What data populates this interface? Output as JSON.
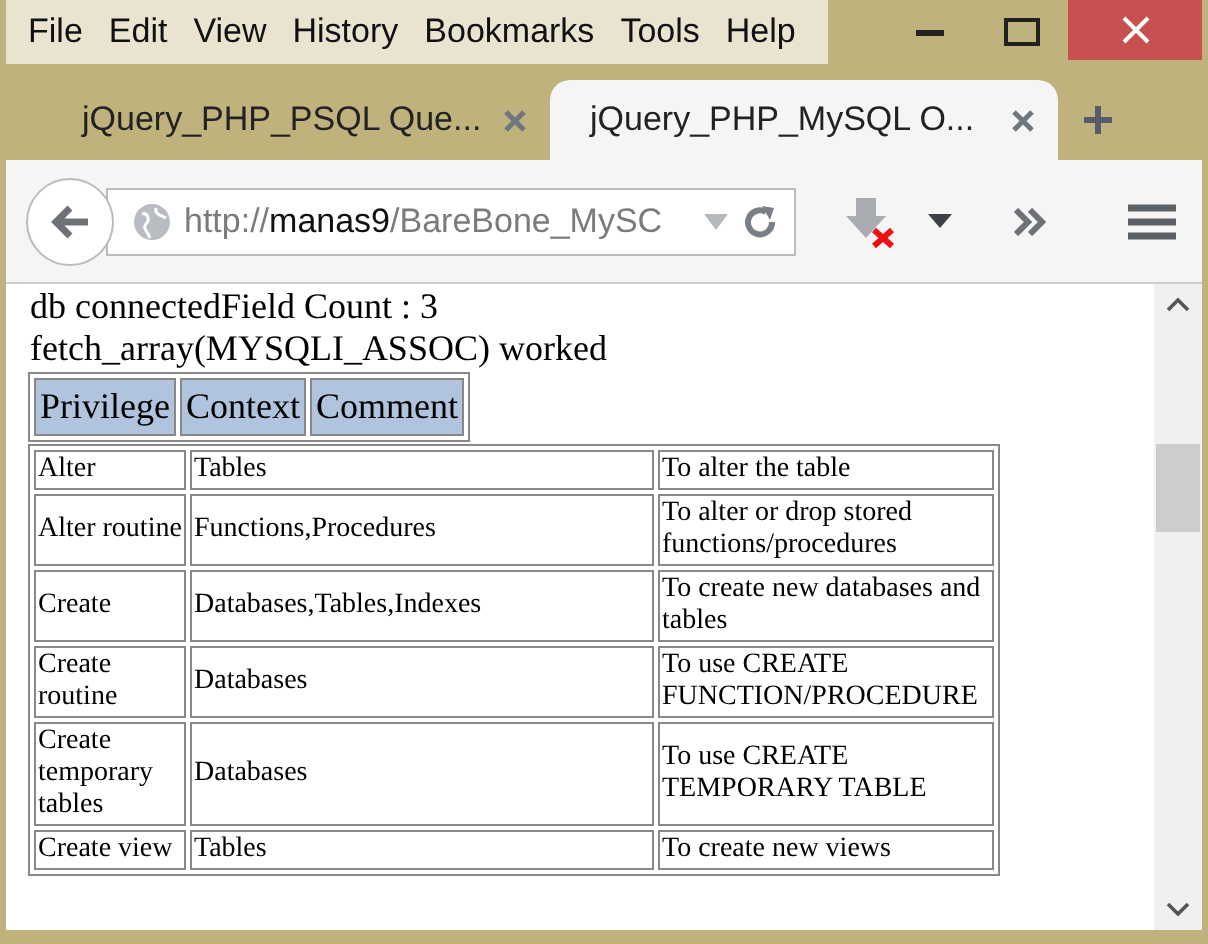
{
  "menu": [
    {
      "label": "File"
    },
    {
      "label": "Edit"
    },
    {
      "label": "View"
    },
    {
      "label": "History"
    },
    {
      "label": "Bookmarks"
    },
    {
      "label": "Tools"
    },
    {
      "label": "Help"
    }
  ],
  "tabs": [
    {
      "label": "jQuery_PHP_PSQL Que...",
      "selected": false
    },
    {
      "label": "jQuery_PHP_MySQL O...",
      "selected": true
    }
  ],
  "address": {
    "scheme": "http://",
    "host": "manas9",
    "path": "/BareBone_MySC"
  },
  "page": {
    "lines": [
      "db connectedField Count : 3",
      "fetch_array(MYSQLI_ASSOC) worked"
    ],
    "header": [
      "Privilege",
      "Context",
      "Comment"
    ],
    "rows": [
      [
        "Alter",
        "Tables",
        "To alter the table"
      ],
      [
        "Alter routine",
        "Functions,Procedures",
        "To alter or drop stored functions/procedures"
      ],
      [
        "Create",
        "Databases,Tables,Indexes",
        "To create new databases and tables"
      ],
      [
        "Create routine",
        "Databases",
        "To use CREATE FUNCTION/PROCEDURE"
      ],
      [
        "Create temporary tables",
        "Databases",
        "To use CREATE TEMPORARY TABLE"
      ],
      [
        "Create view",
        "Tables",
        "To create new views"
      ]
    ]
  }
}
